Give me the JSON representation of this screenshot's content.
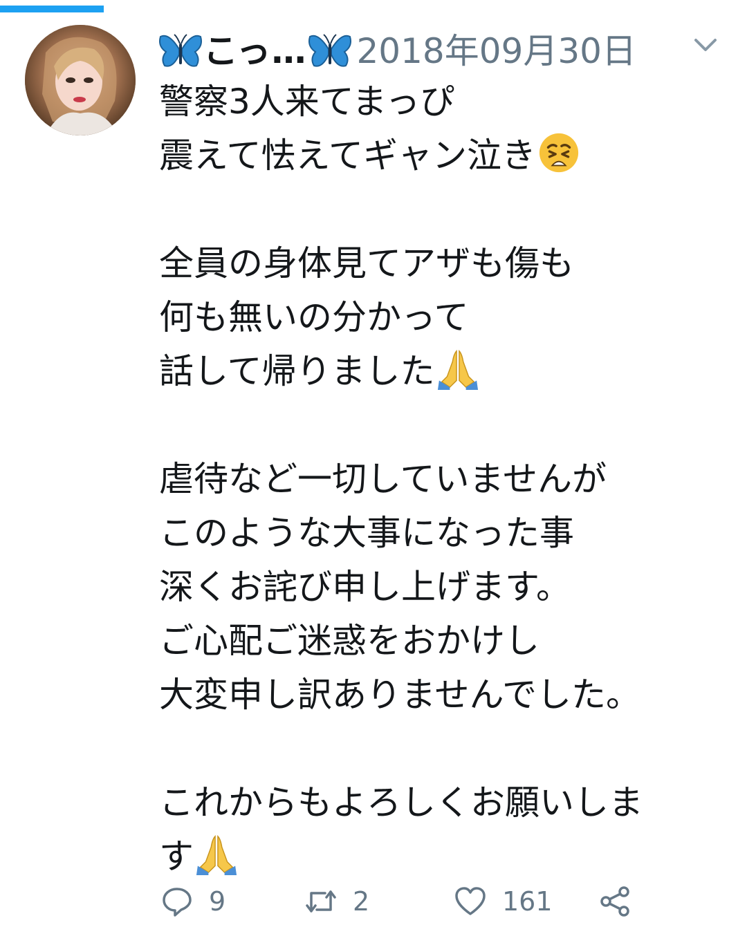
{
  "tweet": {
    "user_name": "こっ…",
    "timestamp": "2018年09月30日",
    "lines": [
      "警察3人来てまっぴ",
      "震えて怯えてギャン泣き",
      "",
      "全員の身体見てアザも傷も",
      "何も無いの分かって",
      "話して帰りました",
      "",
      "虐待など一切していませんが",
      "このような大事になった事",
      "深くお詫び申し上げます。",
      "ご心配ご迷惑をおかけし",
      "大変申し訳ありませんでした。",
      "",
      "これからもよろしくお願いしま",
      "す"
    ],
    "line_emojis": {
      "1": "weary-face-emoji",
      "5": "folded-hands-emoji",
      "14": "folded-hands-emoji"
    }
  },
  "actions": {
    "reply": {
      "icon": "reply-icon",
      "count": "9"
    },
    "retweet": {
      "icon": "retweet-icon",
      "count": "2"
    },
    "like": {
      "icon": "heart-icon",
      "count": "161"
    },
    "share": {
      "icon": "share-icon"
    }
  },
  "colors": {
    "accent": "#1da1f2",
    "text": "#14171a",
    "muted": "#657786",
    "butterfly": "#2f8fd8"
  }
}
